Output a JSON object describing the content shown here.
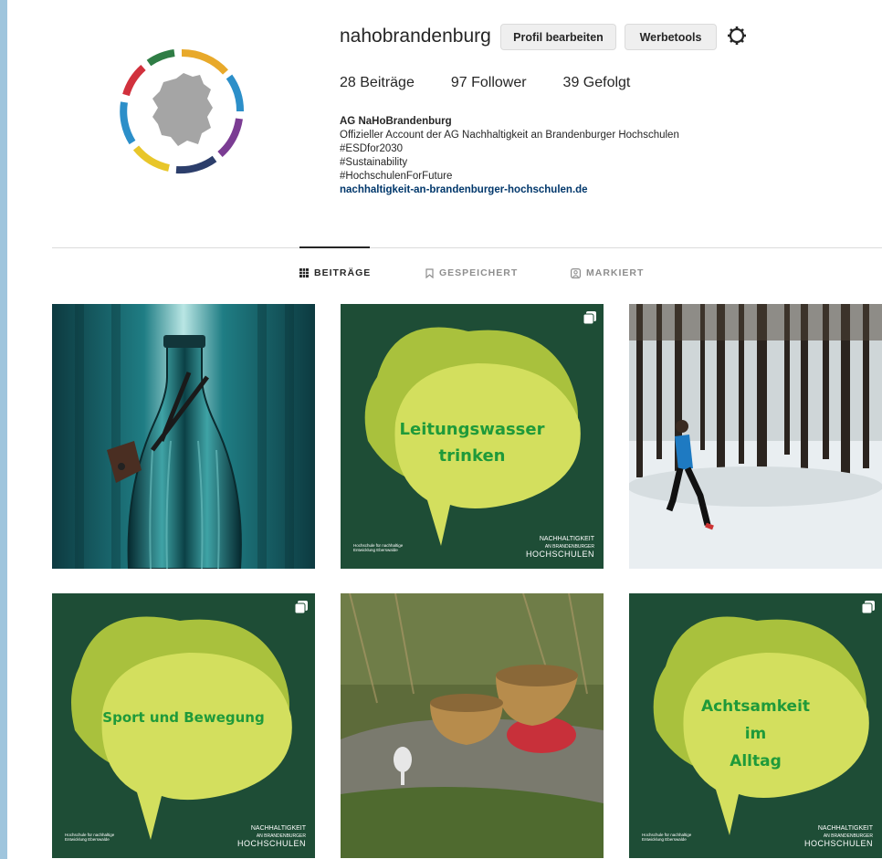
{
  "profile": {
    "username": "nahobrandenburg",
    "edit_button": "Profil bearbeiten",
    "ads_button": "Werbetools",
    "posts_count": "28 Beiträge",
    "followers_count": "97 Follower",
    "following_count": "39 Gefolgt",
    "bio_name": "AG NaHoBrandenburg",
    "bio_lines": [
      "Offizieller Account der AG Nachhaltigkeit an Brandenburger Hochschulen",
      "#ESDfor2030",
      "#Sustainability",
      "#HochschulenForFuture"
    ],
    "bio_link": "nachhaltigkeit-an-brandenburger-hochschulen.de"
  },
  "tabs": {
    "posts": "BEITRÄGE",
    "saved": "GESPEICHERT",
    "tagged": "MARKIERT"
  },
  "posts": {
    "p2_text_1": "Leitungswasser",
    "p2_text_2": "trinken",
    "p4_text": "Sport und Bewegung",
    "p6_text_1": "Achtsamkeit",
    "p6_text_2": "im",
    "p6_text_3": "Alltag",
    "brand_main": "NACHHALTIGKEIT",
    "brand_sub": "AN BRANDENBURGER",
    "brand_bottom": "HOCHSCHULEN",
    "small_logo": "Hochschule für nachhaltige Entwicklung Eberswalde"
  },
  "colors": {
    "tile_green": "#1e4d36",
    "bubble_dark": "#a9c13d",
    "bubble_light": "#d3df5e",
    "bubble_text": "#1f9a3a",
    "link": "#00376b"
  }
}
